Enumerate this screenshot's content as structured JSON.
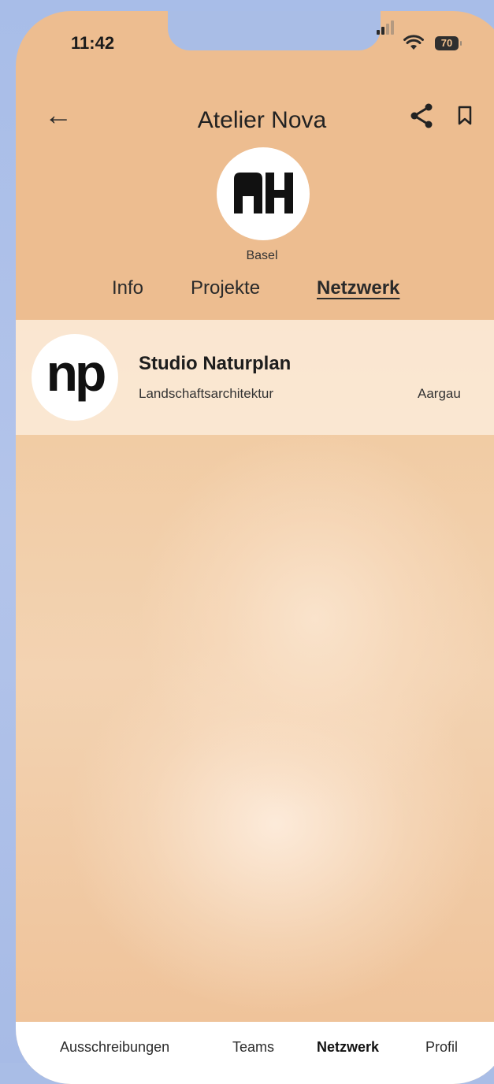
{
  "status_bar": {
    "time": "11:42",
    "battery": "70"
  },
  "header": {
    "title": "Atelier Nova",
    "back_icon": "arrow-left-icon",
    "share_icon": "share-icon",
    "bookmark_icon": "bookmark-icon"
  },
  "profile": {
    "logo_text": "AH",
    "city": "Basel"
  },
  "tabs": [
    {
      "label": "Info"
    },
    {
      "label": "Projekte"
    },
    {
      "label": "Netzwerk",
      "active": true
    }
  ],
  "network": {
    "items": [
      {
        "logo_text": "np",
        "name": "Studio Naturplan",
        "category": "Landschaftsarchitektur",
        "location": "Aargau"
      }
    ]
  },
  "bottom_nav": {
    "items": [
      {
        "label": "Ausschreibungen"
      },
      {
        "label": "Teams"
      },
      {
        "label": "Netzwerk",
        "active": true
      },
      {
        "label": "Profil"
      }
    ]
  },
  "colors": {
    "header_bg": "#edbd90",
    "text_dark": "#222222",
    "nav_bg": "#ffffff"
  }
}
